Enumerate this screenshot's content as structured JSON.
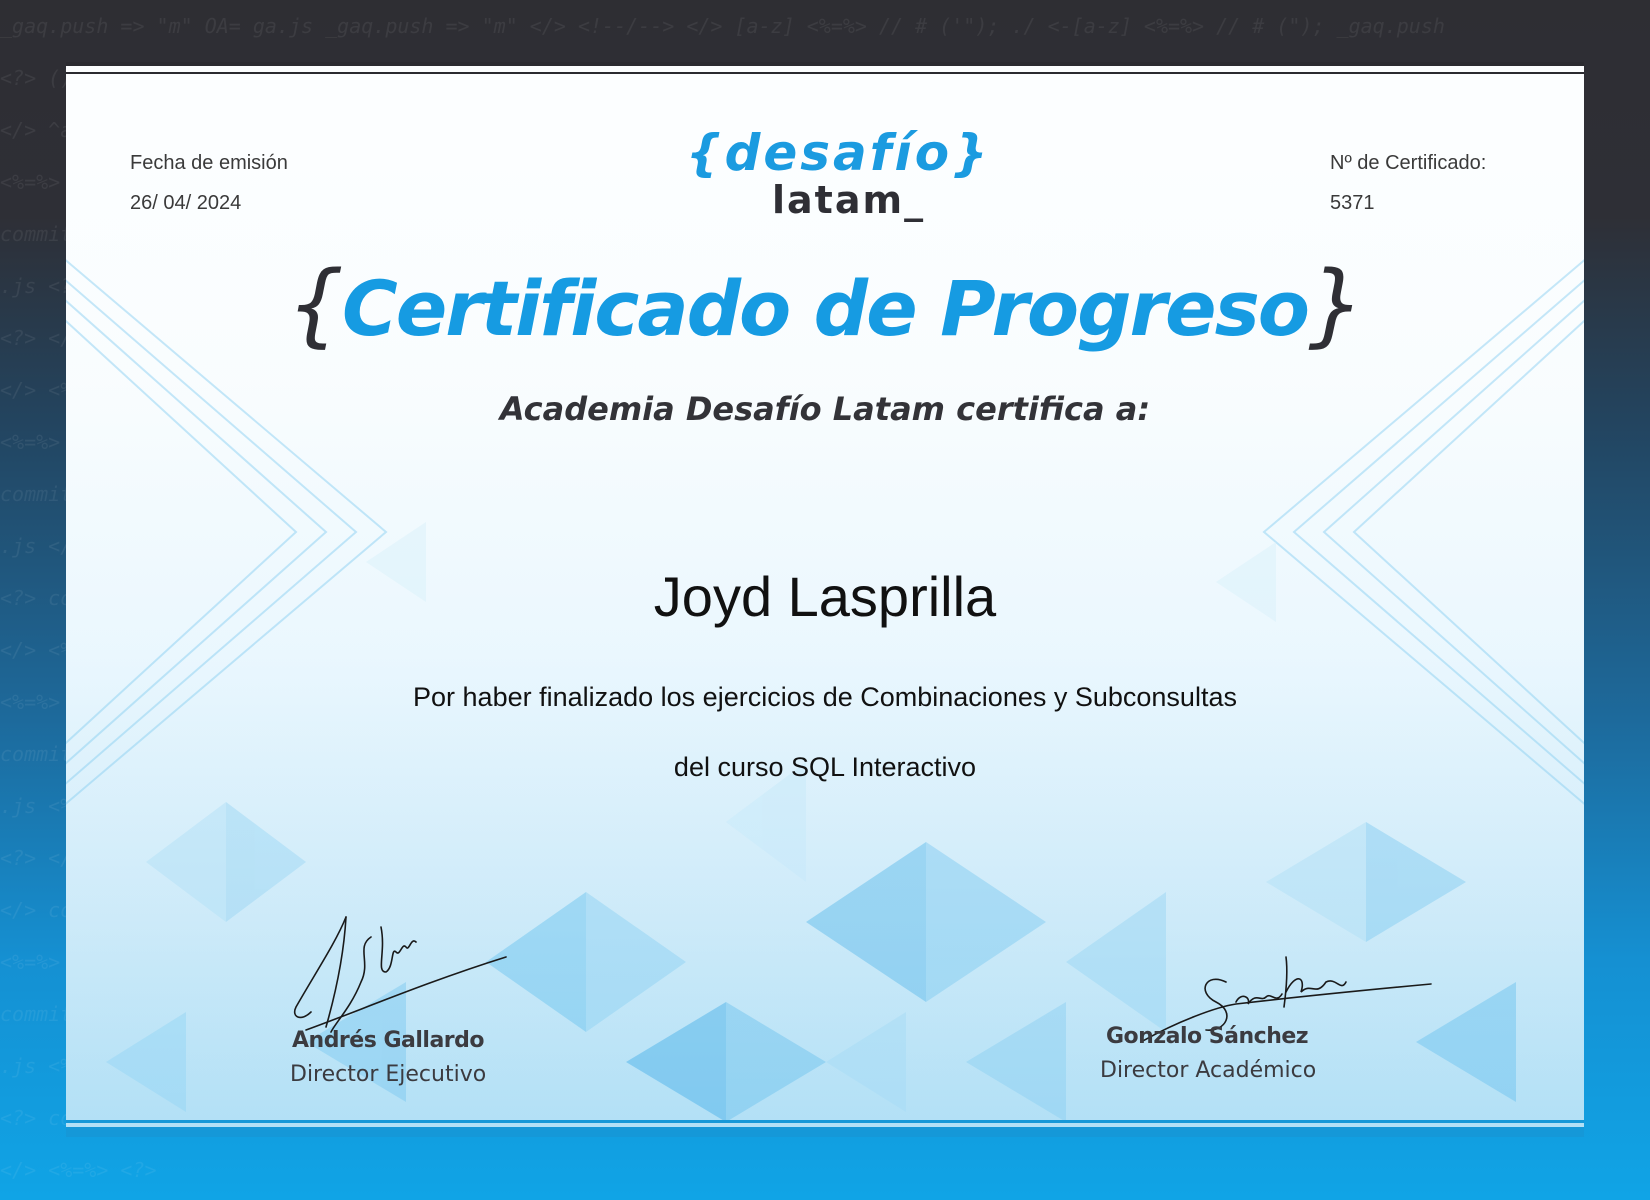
{
  "issue": {
    "label": "Fecha de emisión",
    "date": "26/ 04/ 2024"
  },
  "certificate_no": {
    "label": "Nº de Certificado:",
    "value": "5371"
  },
  "logo": {
    "top": "{desafío}",
    "bottom": "latam_"
  },
  "title": {
    "open_brace": "{",
    "text": "Certificado de Progreso",
    "close_brace": "}"
  },
  "subtitle": "Academia Desafío Latam certifica a:",
  "recipient": "Joyd Lasprilla",
  "reason_line1": "Por haber finalizado los ejercicios de Combinaciones y Subconsultas",
  "reason_line2": "del curso SQL Interactivo",
  "signatories": [
    {
      "name": "Andrés Gallardo",
      "role": "Director Ejecutivo"
    },
    {
      "name": "Gonzalo Sánchez",
      "role": "Director Académico"
    }
  ],
  "colors": {
    "brand_blue": "#169be2",
    "dark": "#2f2f35"
  }
}
